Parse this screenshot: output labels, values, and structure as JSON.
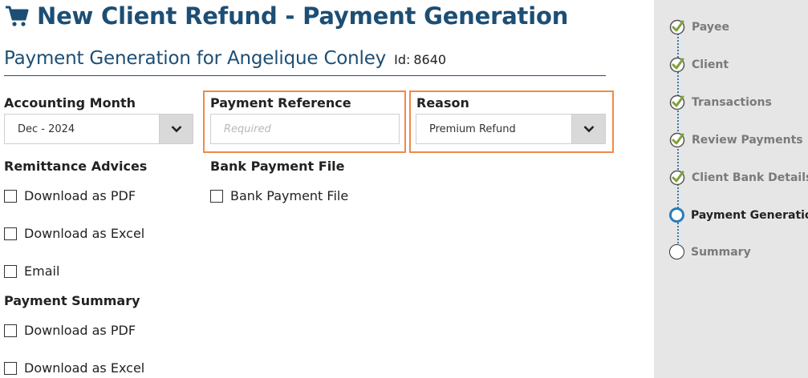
{
  "header": {
    "title": "New Client Refund - Payment Generation",
    "icon": "shopping-cart-icon"
  },
  "sub_header": {
    "title": "Payment Generation for Angelique Conley",
    "id_label": "Id:",
    "id_value": "8640"
  },
  "form": {
    "accounting_month": {
      "label": "Accounting Month",
      "value": "Dec - 2024"
    },
    "payment_reference": {
      "label": "Payment Reference",
      "placeholder": "Required",
      "value": ""
    },
    "reason": {
      "label": "Reason",
      "value": "Premium Refund"
    },
    "remittance_advices": {
      "label": "Remittance Advices",
      "options": [
        {
          "label": "Download as PDF",
          "checked": false
        },
        {
          "label": "Download as Excel",
          "checked": false
        },
        {
          "label": "Email",
          "checked": false
        }
      ]
    },
    "bank_payment_file": {
      "label": "Bank Payment File",
      "options": [
        {
          "label": "Bank Payment File",
          "checked": false
        }
      ]
    },
    "payment_summary": {
      "label": "Payment Summary",
      "options": [
        {
          "label": "Download as PDF",
          "checked": false
        },
        {
          "label": "Download as Excel",
          "checked": false
        }
      ]
    }
  },
  "steps": [
    {
      "label": "Payee",
      "status": "done"
    },
    {
      "label": "Client",
      "status": "done"
    },
    {
      "label": "Transactions",
      "status": "done"
    },
    {
      "label": "Review Payments",
      "status": "done"
    },
    {
      "label": "Client Bank Details",
      "status": "done"
    },
    {
      "label": "Payment Generation",
      "status": "current"
    },
    {
      "label": "Summary",
      "status": "pending"
    }
  ],
  "colors": {
    "title": "#1d4e74",
    "highlight": "#ef8a48",
    "step_done": "#7fa13a",
    "step_current": "#2a7cb8",
    "sidebar_bg": "#e6e6e6"
  }
}
